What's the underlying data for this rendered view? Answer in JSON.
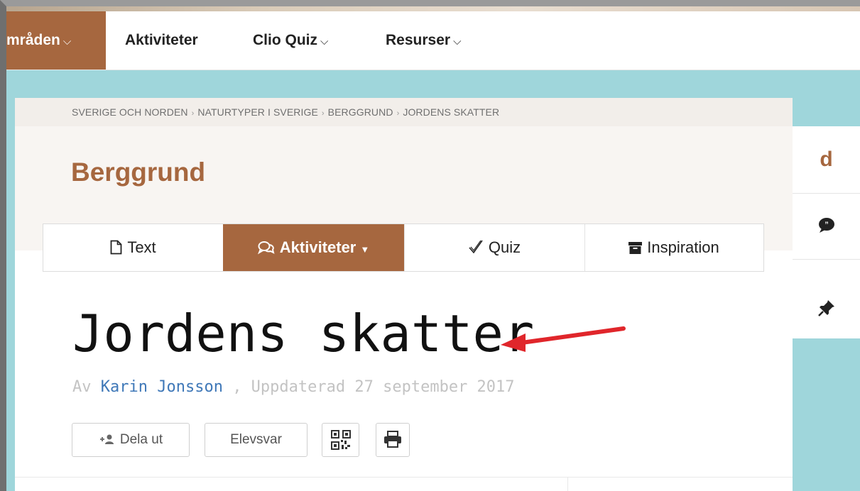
{
  "nav": {
    "items": [
      {
        "label": "mråden",
        "active": true
      },
      {
        "label": "Aktiviteter",
        "active": false
      },
      {
        "label": "Clio Quiz",
        "active": false
      },
      {
        "label": "Resurser",
        "active": false
      }
    ]
  },
  "breadcrumb": [
    "SVERIGE OCH NORDEN",
    "NATURTYPER I SVERIGE",
    "BERGGRUND",
    "JORDENS SKATTER"
  ],
  "breadcrumb_separator": "›",
  "page_title": "Berggrund",
  "tabs": [
    {
      "label": "Text",
      "icon": "document-icon"
    },
    {
      "label": "Aktiviteter",
      "icon": "chat-bubbles-icon",
      "active": true
    },
    {
      "label": "Quiz",
      "icon": "checkmark-icon"
    },
    {
      "label": "Inspiration",
      "icon": "archive-box-icon"
    }
  ],
  "side_panel": {
    "letter": "d",
    "icons": [
      "speech-bubble-icon",
      "pin-icon"
    ]
  },
  "article": {
    "heading": "Jordens skatter",
    "byline_prefix": "Av",
    "author": "Karin Jonsson",
    "byline_suffix": ", Uppdaterad 27 september 2017"
  },
  "actions": {
    "share_label": "Dela ut",
    "student_answers_label": "Elevsvar"
  },
  "colors": {
    "accent": "#a6673f",
    "teal": "#9fd6db",
    "link": "#3f78b8",
    "arrow": "#e0262b"
  }
}
